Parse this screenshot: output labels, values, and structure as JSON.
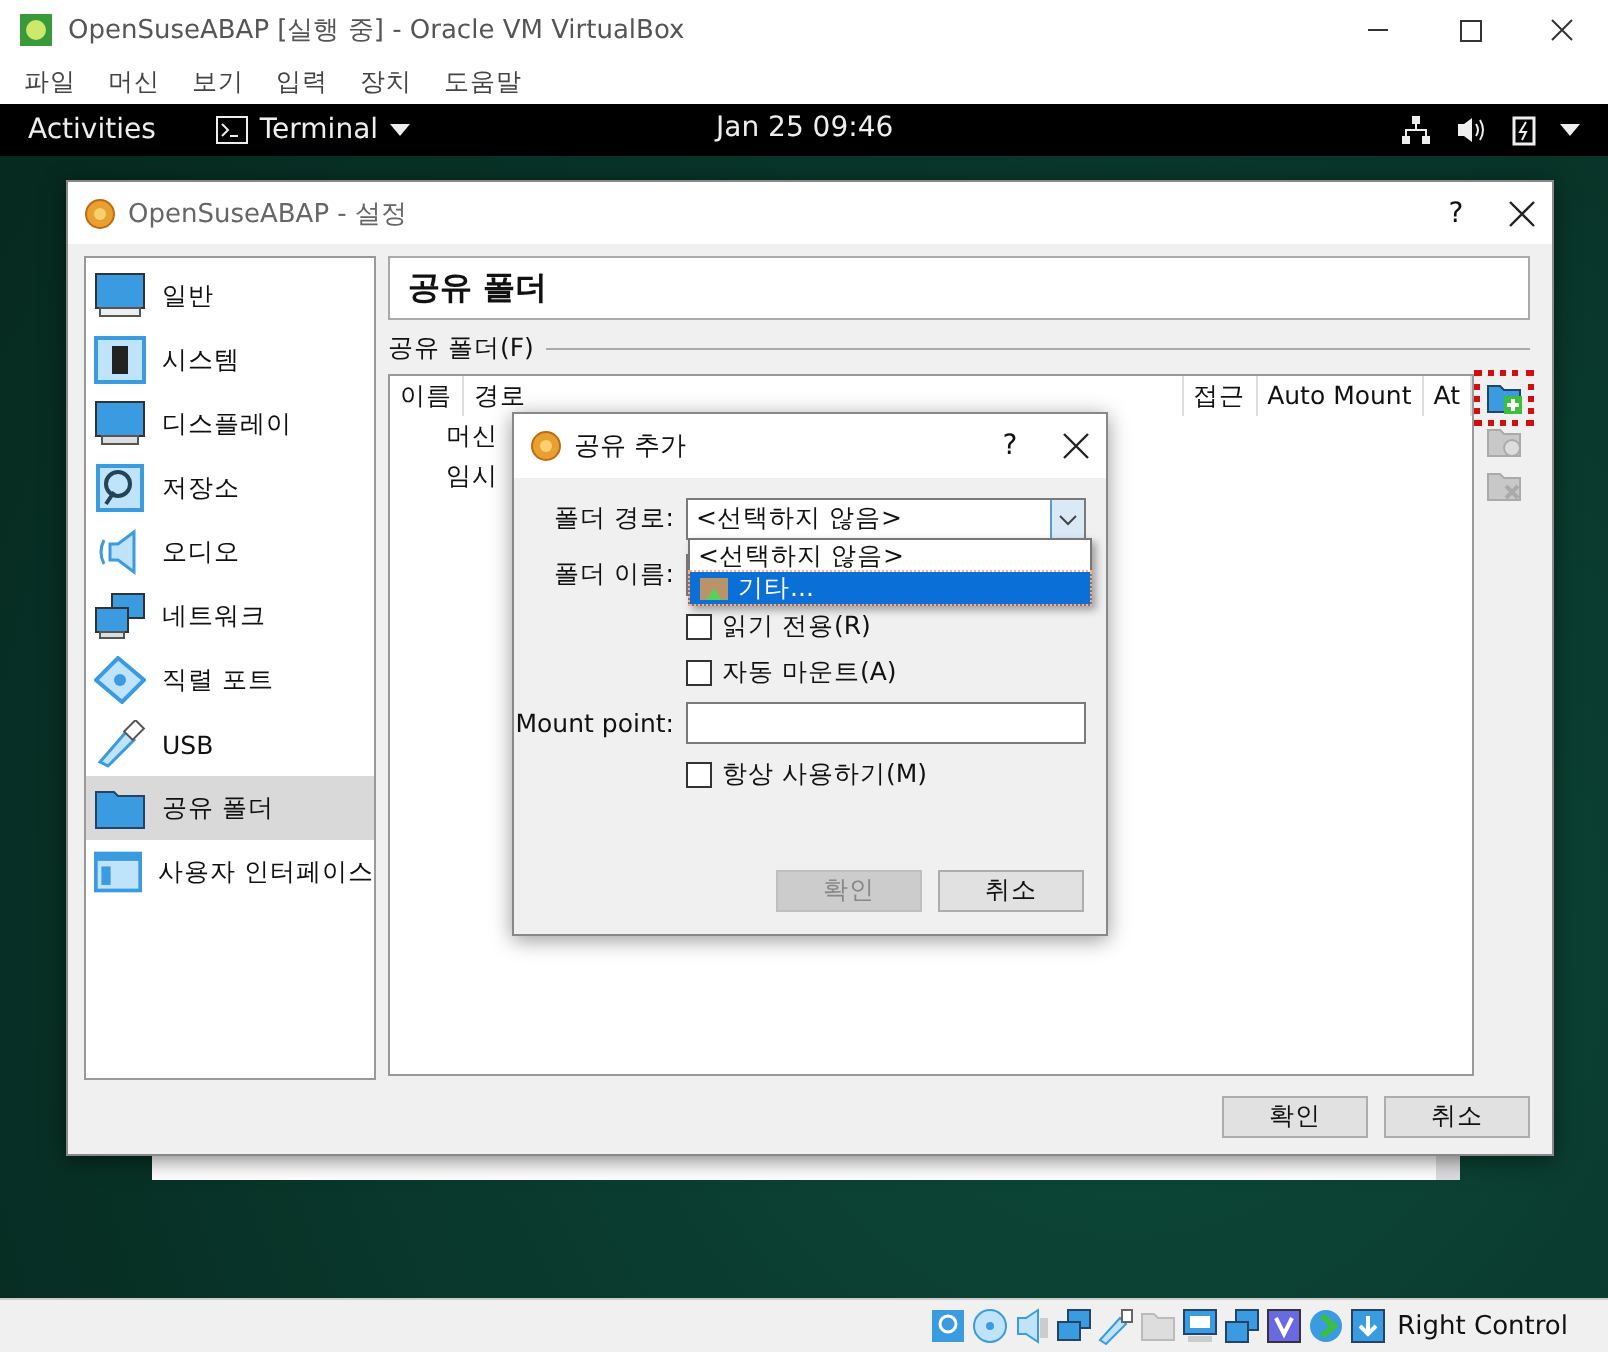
{
  "window": {
    "title": "OpenSuseABAP [실행 중] - Oracle VM VirtualBox"
  },
  "menu": [
    "파일",
    "머신",
    "보기",
    "입력",
    "장치",
    "도움말"
  ],
  "guest_top_bar": {
    "activities": "Activities",
    "app": "Terminal",
    "clock": "Jan 25  09:46"
  },
  "settings_dialog": {
    "title": "OpenSuseABAP - 설정",
    "help": "?",
    "categories": [
      {
        "kind": "general",
        "label": "일반",
        "selected": false
      },
      {
        "kind": "system",
        "label": "시스템",
        "selected": false
      },
      {
        "kind": "display",
        "label": "디스플레이",
        "selected": false
      },
      {
        "kind": "storage",
        "label": "저장소",
        "selected": false
      },
      {
        "kind": "audio",
        "label": "오디오",
        "selected": false
      },
      {
        "kind": "network",
        "label": "네트워크",
        "selected": false
      },
      {
        "kind": "serial",
        "label": "직렬 포트",
        "selected": false
      },
      {
        "kind": "usb",
        "label": "USB",
        "selected": false
      },
      {
        "kind": "shared",
        "label": "공유 폴더",
        "selected": true
      },
      {
        "kind": "ui",
        "label": "사용자 인터페이스",
        "selected": false
      }
    ],
    "page_title": "공유 폴더",
    "group_label": "공유 폴더(F)",
    "columns": [
      "이름",
      "경로",
      "접근",
      "Auto Mount",
      "At"
    ],
    "rows": [
      {
        "name": "머신"
      },
      {
        "name": "임시"
      }
    ],
    "tools": [
      {
        "kind": "add",
        "disabled": false,
        "highlighted": true
      },
      {
        "kind": "edit",
        "disabled": true,
        "highlighted": false
      },
      {
        "kind": "remove",
        "disabled": true,
        "highlighted": false
      }
    ],
    "buttons": [
      "확인",
      "취소"
    ]
  },
  "add_share_dialog": {
    "title": "공유 추가",
    "help": "?",
    "folder_path": {
      "label": "폴더 경로:",
      "value": "<선택하지 않음>"
    },
    "options": [
      {
        "label": "<선택하지 않음>",
        "selected": false,
        "icon": false
      },
      {
        "label": "기타...",
        "selected": true,
        "icon": true
      }
    ],
    "folder_name": {
      "label": "폴더 이름:"
    },
    "read_only": {
      "label": "읽기 전용(R)",
      "checked": false
    },
    "auto_mount": {
      "label": "자동 마운트(A)",
      "checked": false
    },
    "mount_point": {
      "label": "Mount point:"
    },
    "permanent": {
      "label": "항상 사용하기(M)",
      "checked": false
    },
    "buttons": [
      {
        "label": "확인",
        "disabled": true
      },
      {
        "label": "취소",
        "disabled": false
      }
    ]
  },
  "status_bar": {
    "host_key": "Right Control"
  }
}
